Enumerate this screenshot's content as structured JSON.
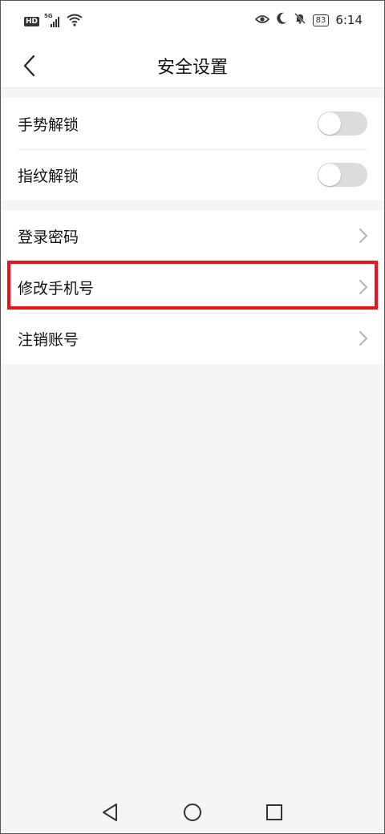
{
  "status_bar": {
    "hd_label": "HD",
    "network_label": "5G",
    "battery": "83",
    "time": "6:14",
    "icons": [
      "hd-icon",
      "signal-icon",
      "wifi-icon",
      "eye-icon",
      "moon-icon",
      "bell-off-icon",
      "battery-icon"
    ]
  },
  "header": {
    "title": "安全设置",
    "back_icon": "chevron-left-icon"
  },
  "groups": [
    {
      "items": [
        {
          "label": "手势解锁",
          "control": "toggle",
          "on": false
        },
        {
          "label": "指纹解锁",
          "control": "toggle",
          "on": false
        }
      ]
    },
    {
      "items": [
        {
          "label": "登录密码",
          "control": "chevron"
        },
        {
          "label": "修改手机号",
          "control": "chevron",
          "highlighted": true
        },
        {
          "label": "注销账号",
          "control": "chevron"
        }
      ]
    }
  ],
  "highlight_color": "#e8131b",
  "toggle_off_color": "#dcdcdc",
  "nav_bar": {
    "icons": [
      "back-triangle-icon",
      "home-circle-icon",
      "recents-square-icon"
    ]
  }
}
